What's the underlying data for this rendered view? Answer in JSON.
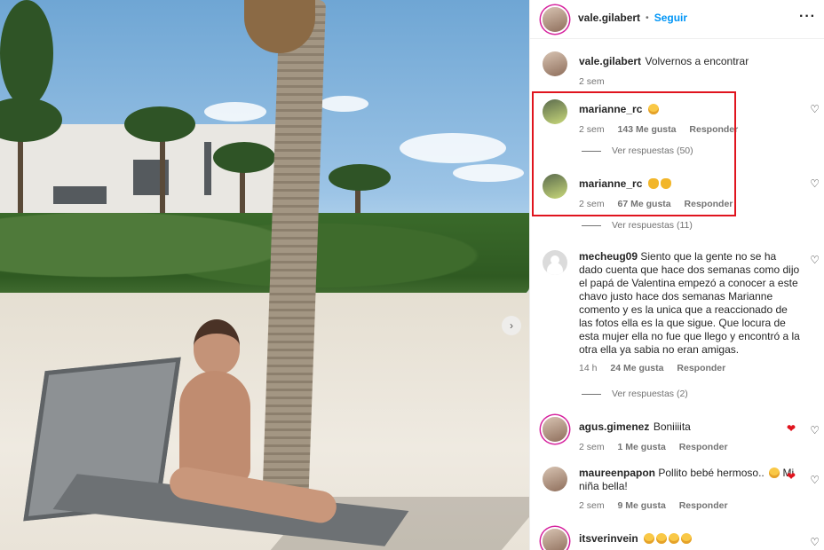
{
  "header": {
    "username": "vale.gilabert",
    "separator": "•",
    "follow_label": "Seguir",
    "more_label": "···"
  },
  "caption": {
    "username": "vale.gilabert",
    "text": "Volvernos a encontrar",
    "time": "2 sem"
  },
  "comments": [
    {
      "username": "marianne_rc",
      "text": "",
      "emojis": [
        "face"
      ],
      "time": "2 sem",
      "likes": "143 Me gusta",
      "reply": "Responder",
      "view_replies": "Ver respuestas (50)"
    },
    {
      "username": "marianne_rc",
      "text": "",
      "emojis": [
        "clap",
        "clap"
      ],
      "time": "2 sem",
      "likes": "67 Me gusta",
      "reply": "Responder",
      "view_replies": "Ver respuestas (11)"
    },
    {
      "username": "mecheug09",
      "text": "Siento que la gente no se ha dado cuenta que hace dos semanas como dijo el papá de Valentina empezó a conocer a este chavo justo hace dos semanas Marianne comento y es la unica que a reaccionado de las fotos ella es la que sigue. Que locura de esta mujer ella no fue que llego y encontró a la otra ella ya sabia no eran amigas.",
      "time": "14 h",
      "likes": "24 Me gusta",
      "reply": "Responder",
      "view_replies": "Ver respuestas (2)"
    },
    {
      "username": "agus.gimenez",
      "text": "Boniiiita",
      "emojis": [
        "heart",
        "heart"
      ],
      "time": "2 sem",
      "likes": "1 Me gusta",
      "reply": "Responder"
    },
    {
      "username": "maureenpapon",
      "text": "Pollito bebé hermoso..",
      "text2": "Mi niña bella!",
      "time": "2 sem",
      "likes": "9 Me gusta",
      "reply": "Responder"
    },
    {
      "username": "itsverinvein",
      "text": ""
    }
  ],
  "icons": {
    "heart_outline": "♡",
    "heart_filled": "❤",
    "chevron_right": "›"
  },
  "colors": {
    "follow": "#0095f6",
    "highlight": "#e0141e"
  }
}
